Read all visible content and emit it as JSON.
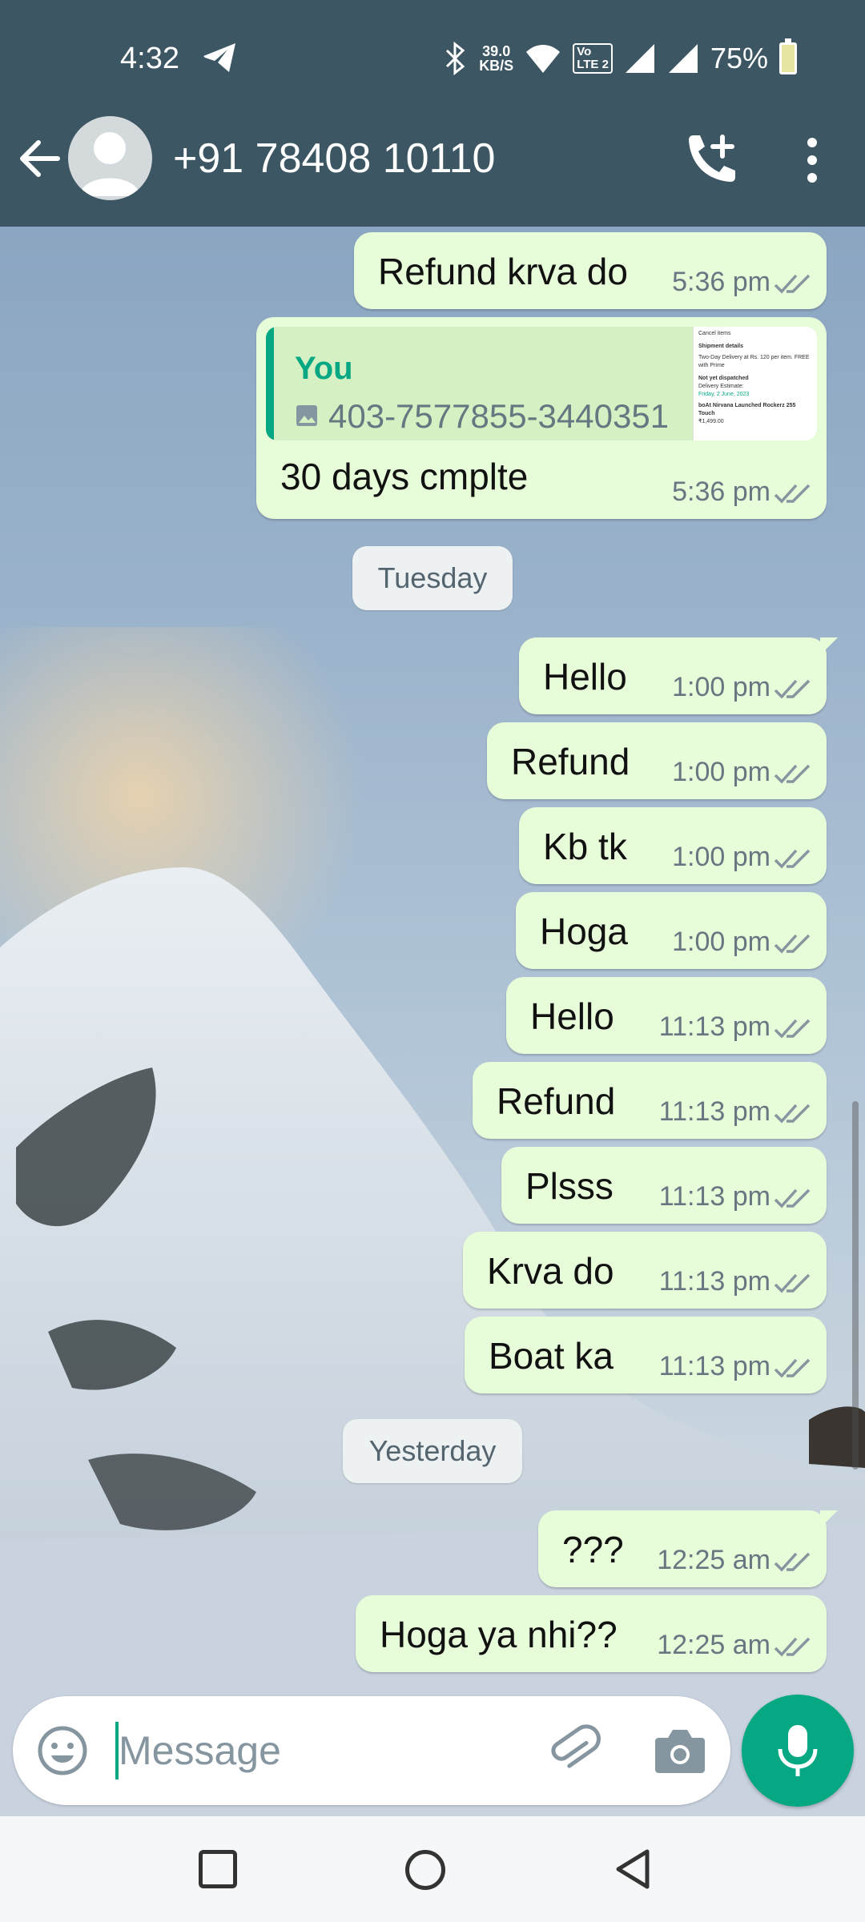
{
  "status_bar": {
    "time": "4:32",
    "net_speed_value": "39.0",
    "net_speed_unit": "KB/S",
    "volte_top": "Vo",
    "volte_bottom": "LTE 2",
    "battery": "75%"
  },
  "header": {
    "contact_name": "+91 78408 10110",
    "icons": [
      "back-arrow-icon",
      "avatar",
      "add-call-icon",
      "more-vert-icon"
    ]
  },
  "quoted": {
    "author": "You",
    "text": "403-7577855-3440351",
    "thumb_title": "Cancel items",
    "thumb_sub": "Shipment details",
    "thumb_line1": "Two-Day Delivery at Rs. 120 per item. FREE with Prime",
    "thumb_line2": "Not yet dispatched",
    "thumb_line3": "Delivery Estimate:",
    "thumb_line4": "Friday, 2 June, 2023",
    "thumb_item": "boAt Nirvana Launched Rockerz 255 Touch",
    "thumb_price": "₹1,499.00"
  },
  "messages": [
    {
      "text": "Refund krva do",
      "time": "5:36 pm"
    },
    {
      "text": "30 days cmplte",
      "time": "5:36 pm"
    },
    {
      "text": "Hello",
      "time": "1:00 pm"
    },
    {
      "text": "Refund",
      "time": "1:00 pm"
    },
    {
      "text": "Kb tk",
      "time": "1:00 pm"
    },
    {
      "text": "Hoga",
      "time": "1:00 pm"
    },
    {
      "text": "Hello",
      "time": "11:13 pm"
    },
    {
      "text": "Refund",
      "time": "11:13 pm"
    },
    {
      "text": "Plsss",
      "time": "11:13 pm"
    },
    {
      "text": "Krva do",
      "time": "11:13 pm"
    },
    {
      "text": "Boat ka",
      "time": "11:13 pm"
    },
    {
      "text": "???",
      "time": "12:25 am"
    },
    {
      "text": "Hoga ya nhi??",
      "time": "12:25 am"
    }
  ],
  "day_separators": [
    "Tuesday",
    "Yesterday"
  ],
  "composer": {
    "placeholder": "Message",
    "icons": [
      "emoji-icon",
      "attach-icon",
      "camera-icon",
      "mic-icon"
    ]
  },
  "colors": {
    "header": "#3c5663",
    "outgoing_bubble": "#e7fcd9",
    "accent": "#06a884",
    "read_ticks": "#8696a0"
  }
}
